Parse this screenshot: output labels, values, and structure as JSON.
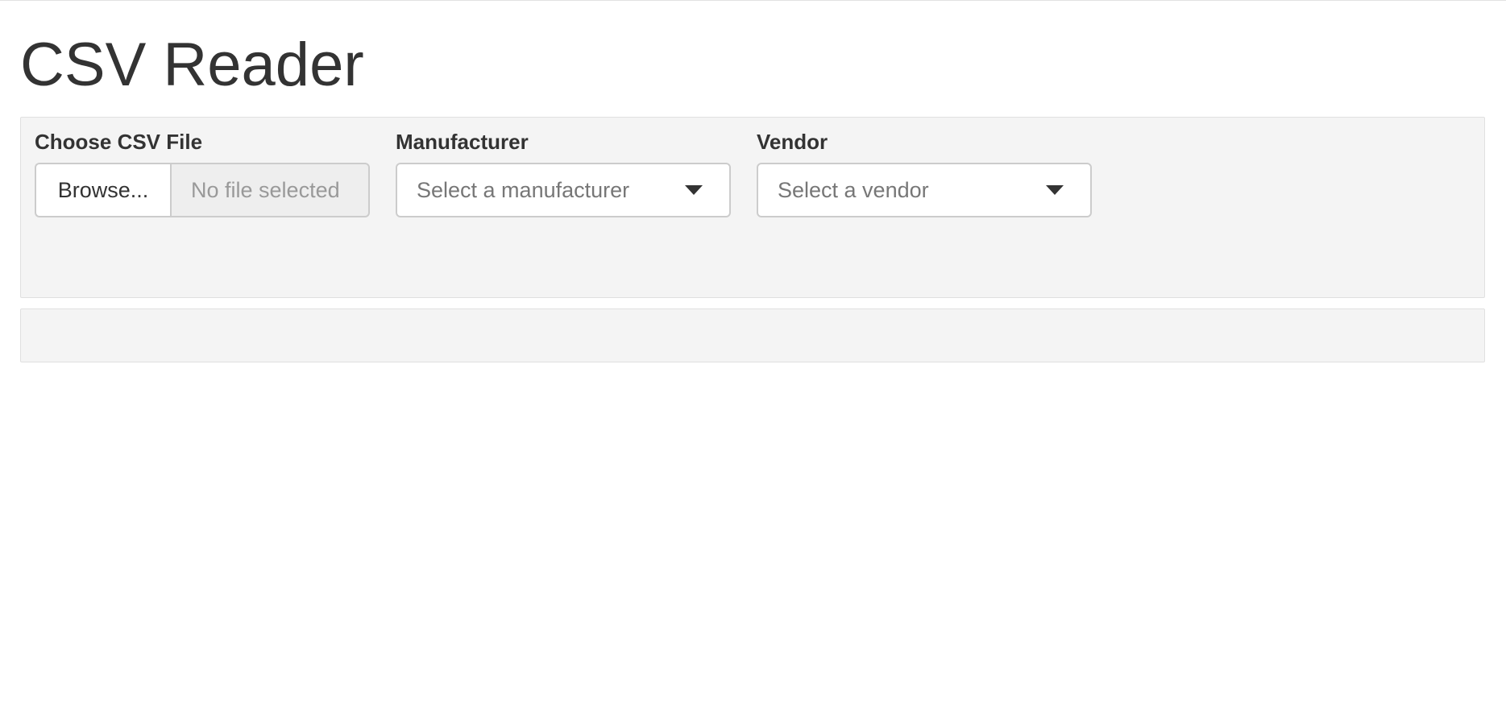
{
  "page": {
    "title": "CSV Reader"
  },
  "file_input": {
    "label": "Choose CSV File",
    "button_label": "Browse...",
    "status_text": "No file selected"
  },
  "manufacturer": {
    "label": "Manufacturer",
    "placeholder": "Select a manufacturer",
    "icon": "chevron-down-icon"
  },
  "vendor": {
    "label": "Vendor",
    "placeholder": "Select a vendor",
    "icon": "chevron-down-icon"
  },
  "colors": {
    "panel_background": "#f4f4f4",
    "panel_border": "#e0e0e0",
    "text": "#333333",
    "placeholder_text": "#777777",
    "file_status_text": "#999999"
  }
}
